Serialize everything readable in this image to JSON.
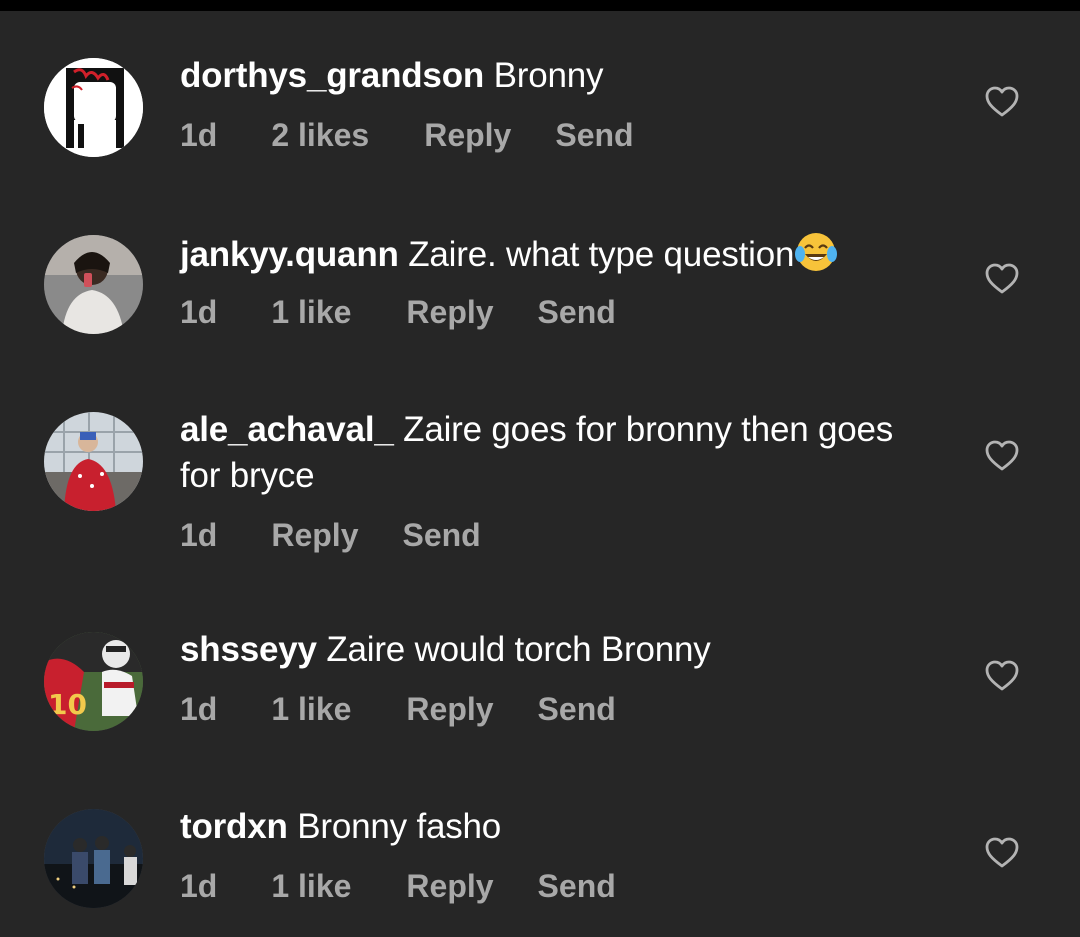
{
  "comments": [
    {
      "username": "dorthys_grandson",
      "text": "Bronny",
      "time": "1d",
      "likes": "2 likes",
      "reply": "Reply",
      "send": "Send",
      "emoji": ""
    },
    {
      "username": "jankyy.quann",
      "text": "Zaire. what type question",
      "time": "1d",
      "likes": "1 like",
      "reply": "Reply",
      "send": "Send",
      "emoji": "face-with-tears-of-joy"
    },
    {
      "username": "ale_achaval_",
      "text": "Zaire goes for bronny then goes for bryce",
      "time": "1d",
      "likes": "",
      "reply": "Reply",
      "send": "Send",
      "emoji": ""
    },
    {
      "username": "shsseyy",
      "text": "Zaire would torch Bronny",
      "time": "1d",
      "likes": "1 like",
      "reply": "Reply",
      "send": "Send",
      "emoji": ""
    },
    {
      "username": "tordxn",
      "text": "Bronny fasho",
      "time": "1d",
      "likes": "1 like",
      "reply": "Reply",
      "send": "Send",
      "emoji": ""
    }
  ],
  "icons": {
    "like": "heart-outline-icon",
    "emoji": "face-with-tears-of-joy"
  },
  "colors": {
    "background": "#262626",
    "primary_text": "#ffffff",
    "secondary_text": "#a8a8a8"
  }
}
